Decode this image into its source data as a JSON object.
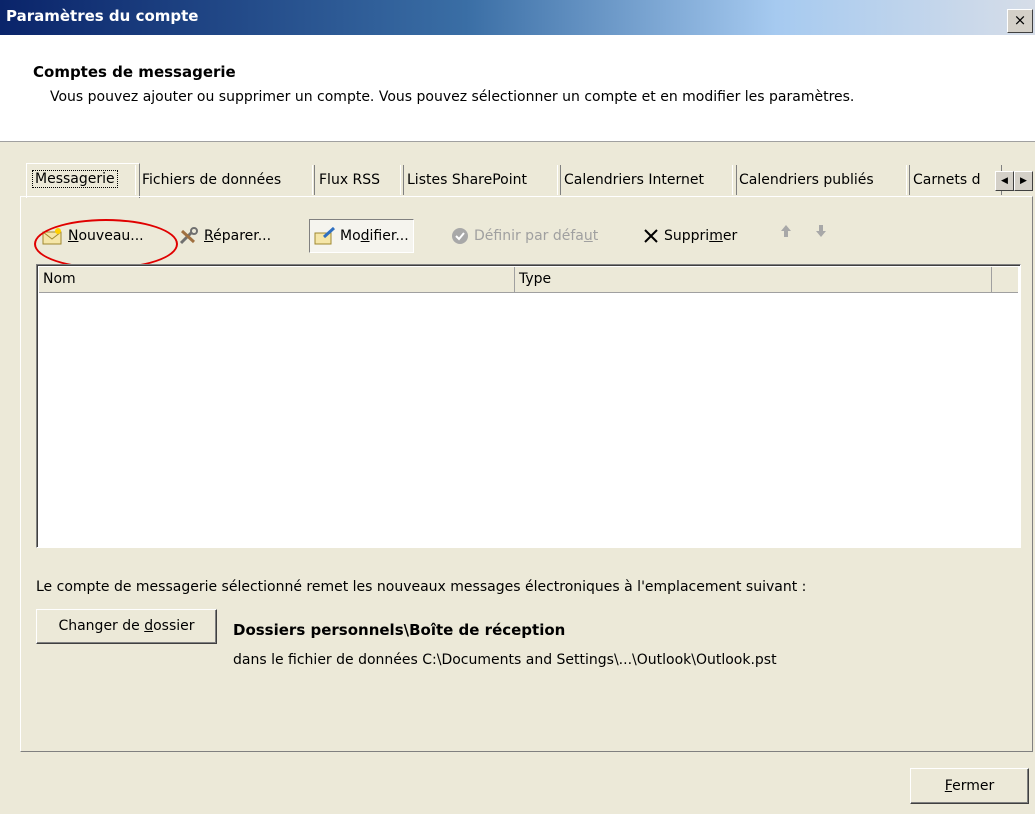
{
  "window": {
    "title": "Paramètres du compte",
    "close_glyph": "×"
  },
  "header": {
    "title": "Comptes de messagerie",
    "description": "Vous pouvez ajouter ou supprimer un compte. Vous pouvez sélectionner un compte et en modifier les paramètres."
  },
  "tabs": [
    {
      "label": "Messagerie",
      "active": true
    },
    {
      "label": "Fichiers de données"
    },
    {
      "label": "Flux RSS"
    },
    {
      "label": "Listes SharePoint"
    },
    {
      "label": "Calendriers Internet"
    },
    {
      "label": "Calendriers publiés"
    },
    {
      "label": "Carnets d"
    }
  ],
  "toolbar": {
    "nouveau": {
      "pre": "",
      "key": "N",
      "post": "ouveau...",
      "icon": "new-mail-icon"
    },
    "reparer": {
      "pre": "",
      "key": "R",
      "post": "éparer...",
      "icon": "repair-tools-icon"
    },
    "modifier": {
      "pre": "Mo",
      "key": "d",
      "post": "ifier...",
      "icon": "modify-icon"
    },
    "definir": {
      "pre": "Définir par défa",
      "key": "u",
      "post": "t",
      "icon": "check-circle-icon"
    },
    "supprimer": {
      "pre": "Suppri",
      "key": "m",
      "post": "er",
      "icon": "delete-x-icon"
    }
  },
  "list": {
    "columns": [
      "Nom",
      "Type"
    ],
    "rows": []
  },
  "delivery": {
    "note": "Le compte de messagerie sélectionné remet les nouveaux messages électroniques à l'emplacement suivant :",
    "change_folder": {
      "pre": "Changer de ",
      "key": "d",
      "post": "ossier"
    },
    "folder": "Dossiers personnels\\Boîte de réception",
    "path": "dans le fichier de données C:\\Documents and Settings\\...\\Outlook\\Outlook.pst"
  },
  "footer": {
    "close": {
      "pre": "",
      "key": "F",
      "post": "ermer"
    }
  },
  "colors": {
    "highlight": "#e00000",
    "titlebar_start": "#0a246a",
    "face": "#ece9d8"
  }
}
